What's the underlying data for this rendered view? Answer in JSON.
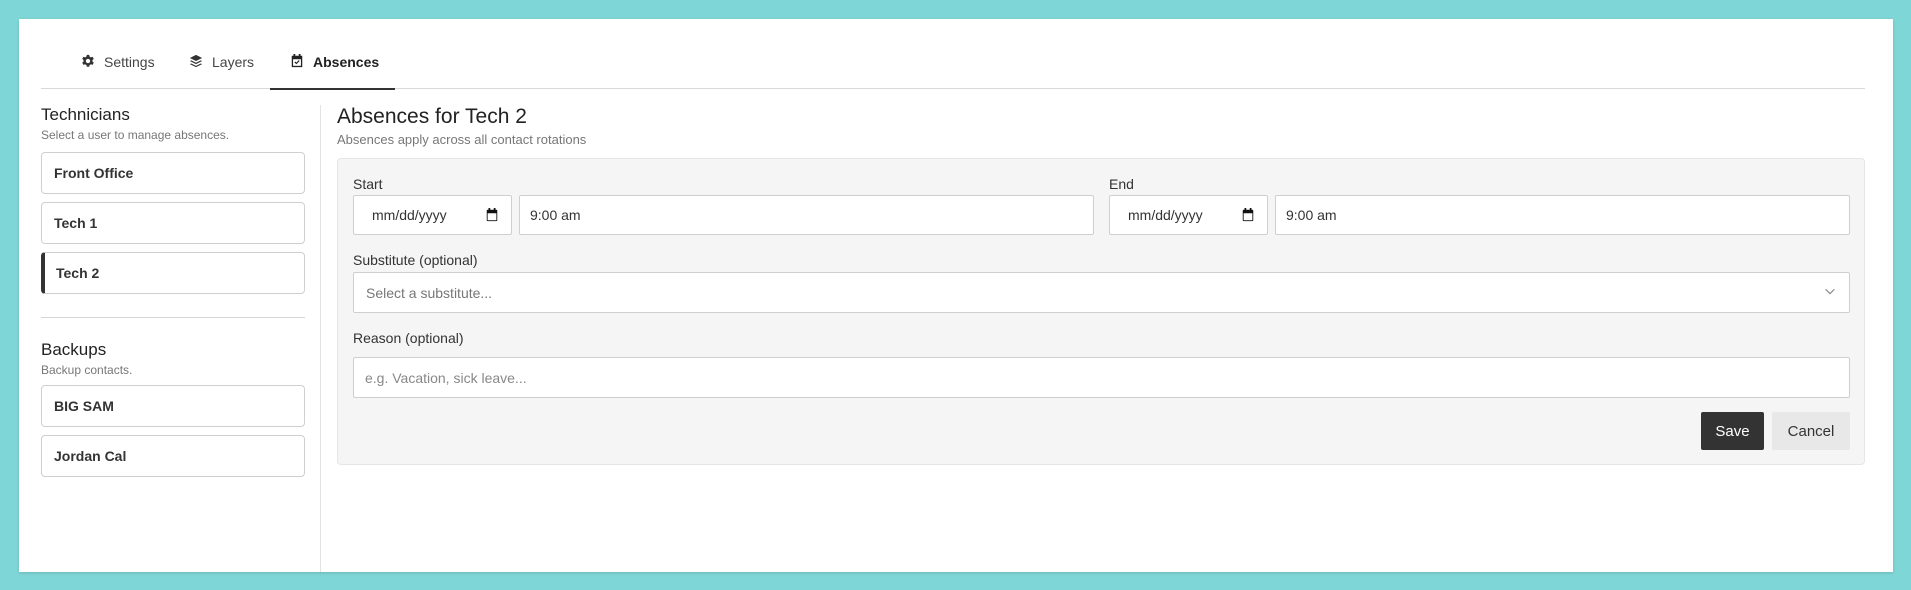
{
  "tabs": [
    {
      "label": "Settings",
      "icon": "gear-icon"
    },
    {
      "label": "Layers",
      "icon": "layers-icon"
    },
    {
      "label": "Absences",
      "icon": "calendar-icon",
      "active": true
    }
  ],
  "sidebar": {
    "technicians": {
      "heading": "Technicians",
      "subtitle": "Select a user to manage absences.",
      "items": [
        "Front Office",
        "Tech 1",
        "Tech 2"
      ],
      "selected": "Tech 2"
    },
    "backups": {
      "heading": "Backups",
      "subtitle": "Backup contacts.",
      "items": [
        "BIG SAM",
        "Jordan Cal"
      ]
    }
  },
  "main": {
    "title": "Absences for Tech 2",
    "subtitle": "Absences apply across all contact rotations",
    "form": {
      "start_label": "Start",
      "start_date_placeholder": "mm/dd/yyyy",
      "start_time": "9:00 am",
      "end_label": "End",
      "end_date_placeholder": "mm/dd/yyyy",
      "end_time": "9:00 am",
      "substitute_label": "Substitute (optional)",
      "substitute_placeholder": "Select a substitute...",
      "reason_label": "Reason (optional)",
      "reason_placeholder": "e.g. Vacation, sick leave...",
      "save_label": "Save",
      "cancel_label": "Cancel"
    }
  },
  "colors": {
    "background": "#7fd6d6",
    "accent": "#333333",
    "panel": "#f5f5f5"
  }
}
